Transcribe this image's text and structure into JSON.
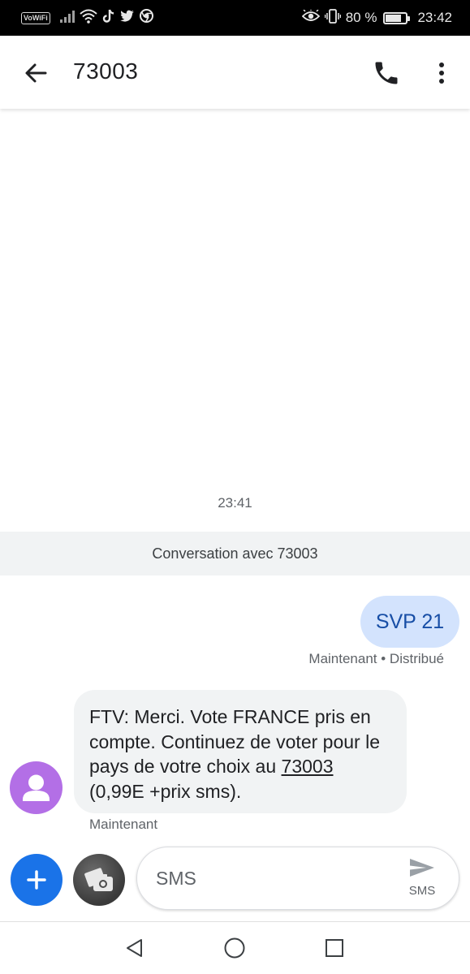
{
  "status_bar": {
    "vowifi_label": "VoWiFi",
    "battery_text": "80 %",
    "battery_level": 0.8,
    "time": "23:42",
    "icons": [
      "signal-icon",
      "wifi-icon",
      "tiktok-icon",
      "twitter-icon",
      "chrome-icon",
      "eye-comfort-icon",
      "vibrate-icon",
      "battery-icon"
    ]
  },
  "app_bar": {
    "title": "73003",
    "back_icon": "arrow-back-icon",
    "call_icon": "phone-icon",
    "more_icon": "more-vert-icon"
  },
  "conversation": {
    "time_divider": "23:41",
    "banner": "Conversation avec 73003",
    "messages": [
      {
        "direction": "outgoing",
        "text": "SVP 21",
        "status": "Maintenant • Distribué"
      },
      {
        "direction": "incoming",
        "text_before_link": "FTV: Merci. Vote FRANCE pris en compte. Continuez de voter pour le pays de votre choix au ",
        "link": "73003",
        "text_after_link": " (0,99E +prix sms).",
        "status": "Maintenant",
        "avatar_color": "#b36fe6"
      }
    ]
  },
  "compose": {
    "placeholder": "SMS",
    "send_label": "SMS",
    "add_icon": "plus-icon",
    "media_icon": "camera-gallery-icon",
    "accent": "#1a73e8"
  },
  "nav_bar": {
    "icons": [
      "nav-back-icon",
      "nav-home-icon",
      "nav-recents-icon"
    ]
  }
}
